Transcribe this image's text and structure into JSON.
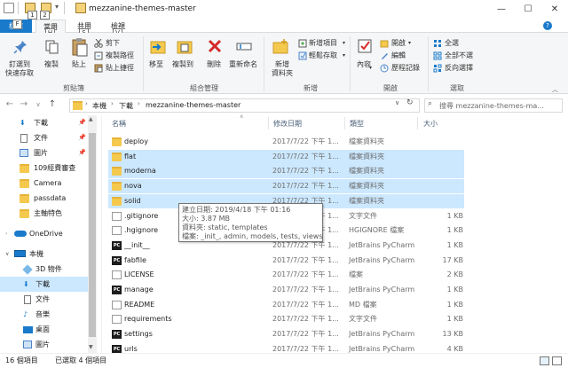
{
  "window": {
    "title": "mezzanine-themes-master",
    "controls": {
      "minimize": "—",
      "maximize": "☐",
      "close": "✕"
    }
  },
  "quick_access_badges": [
    "1",
    "2"
  ],
  "tabs": {
    "file": "檔案",
    "file_badge": "F",
    "items": [
      {
        "label": "常用",
        "badge": "H"
      },
      {
        "label": "共用",
        "badge": "S"
      },
      {
        "label": "檢視",
        "badge": "V"
      }
    ],
    "help": "?"
  },
  "ribbon": {
    "clipboard": {
      "pin": "釘選到\n快速存取",
      "copy": "複製",
      "paste": "貼上",
      "cut": "剪下",
      "copy_path": "複製路徑",
      "paste_shortcut": "貼上捷徑",
      "group_label": "剪貼簿"
    },
    "organize": {
      "move_to": "移至",
      "copy_to": "複製到",
      "delete": "刪除",
      "rename": "重新命名",
      "group_label": "組合管理"
    },
    "new": {
      "new_folder": "新增\n資料夾",
      "new_item": "新增項目",
      "easy_access": "輕鬆存取",
      "group_label": "新增"
    },
    "open": {
      "properties": "內容",
      "open": "開啟",
      "edit": "編輯",
      "history": "歷程記錄",
      "group_label": "開啟"
    },
    "select": {
      "select_all": "全選",
      "select_none": "全部不選",
      "invert": "反向選擇",
      "group_label": "選取"
    }
  },
  "address": {
    "crumbs": [
      "本機",
      "下載",
      "mezzanine-themes-master"
    ],
    "search_placeholder": "搜尋 mezzanine-themes-ma..."
  },
  "nav": {
    "items": [
      {
        "label": "下載",
        "pinned": true
      },
      {
        "label": "文件",
        "pinned": true
      },
      {
        "label": "圖片",
        "pinned": true
      },
      {
        "label": "109經費審查"
      },
      {
        "label": "Camera"
      },
      {
        "label": "passdata"
      },
      {
        "label": "主軸特色"
      },
      {
        "label": "OneDrive"
      },
      {
        "label": "本機"
      },
      {
        "label": "3D 物件"
      },
      {
        "label": "下載"
      },
      {
        "label": "文件"
      },
      {
        "label": "音樂"
      },
      {
        "label": "桌面"
      },
      {
        "label": "圖片"
      }
    ]
  },
  "columns": {
    "name": "名稱",
    "date": "修改日期",
    "type": "類型",
    "size": "大小"
  },
  "files": [
    {
      "name": "deploy",
      "date": "2017/7/22 下午 1...",
      "type": "檔案資料夾",
      "size": "",
      "icon": "folder"
    },
    {
      "name": "flat",
      "date": "2017/7/22 下午 1...",
      "type": "檔案資料夾",
      "size": "",
      "icon": "folder",
      "selected": true
    },
    {
      "name": "moderna",
      "date": "2017/7/22 下午 1...",
      "type": "檔案資料夾",
      "size": "",
      "icon": "folder",
      "selected": true
    },
    {
      "name": "nova",
      "date": "2017/7/22 下午 1...",
      "type": "檔案資料夾",
      "size": "",
      "icon": "folder",
      "selected": true
    },
    {
      "name": "solid",
      "date": "2017/7/22 下午 1...",
      "type": "檔案資料夾",
      "size": "",
      "icon": "folder",
      "selected": true
    },
    {
      "name": ".gitignore",
      "date": "2017/7/22 下午 1...",
      "type": "文字文件",
      "size": "1 KB",
      "icon": "doc"
    },
    {
      "name": ".hgignore",
      "date": "2017/7/22 下午 1...",
      "type": "HGIGNORE 檔案",
      "size": "1 KB",
      "icon": "doc"
    },
    {
      "name": "__init__",
      "date": "2017/7/22 下午 1...",
      "type": "JetBrains PyCharm",
      "size": "1 KB",
      "icon": "pycharm"
    },
    {
      "name": "fabfile",
      "date": "2017/7/22 下午 1...",
      "type": "JetBrains PyCharm",
      "size": "17 KB",
      "icon": "pycharm"
    },
    {
      "name": "LICENSE",
      "date": "2017/7/22 下午 1...",
      "type": "檔案",
      "size": "2 KB",
      "icon": "doc"
    },
    {
      "name": "manage",
      "date": "2017/7/22 下午 1...",
      "type": "JetBrains PyCharm",
      "size": "1 KB",
      "icon": "pycharm"
    },
    {
      "name": "README",
      "date": "2017/7/22 下午 1...",
      "type": "MD 檔案",
      "size": "1 KB",
      "icon": "doc"
    },
    {
      "name": "requirements",
      "date": "2017/7/22 下午 1...",
      "type": "文字文件",
      "size": "1 KB",
      "icon": "doc"
    },
    {
      "name": "settings",
      "date": "2017/7/22 下午 1...",
      "type": "JetBrains PyCharm",
      "size": "13 KB",
      "icon": "pycharm"
    },
    {
      "name": "urls",
      "date": "2017/7/22 下午 1...",
      "type": "JetBrains PyCharm",
      "size": "4 KB",
      "icon": "pycharm"
    },
    {
      "name": "wsgi",
      "date": "2017/7/22 下午 1...",
      "type": "JetBrains PyCharm",
      "size": "1 KB",
      "icon": "pycharm"
    }
  ],
  "tooltip": {
    "line1": "建立日期: 2019/4/18 下午 01:16",
    "line2": "大小: 3.87 MB",
    "line3": "資料夾: static, templates",
    "line4": "檔案: _init_, admin, models, tests, views"
  },
  "status": {
    "count": "16 個項目",
    "selected": "已選取 4 個項目"
  },
  "colors": {
    "accent": "#1979ca",
    "selection": "#cce8ff",
    "folder": "#f4c94e"
  }
}
